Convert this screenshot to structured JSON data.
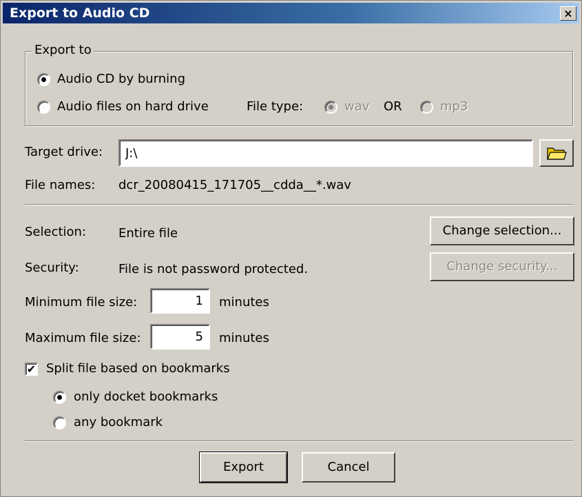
{
  "window": {
    "title": "Export to Audio CD",
    "close_label": "×"
  },
  "export_to": {
    "legend": "Export to",
    "option_cd": "Audio CD by burning",
    "option_files": "Audio files on hard drive",
    "file_type_label": "File type:",
    "wav": "wav",
    "or": "OR",
    "mp3": "mp3",
    "selected": "Audio CD by burning",
    "file_type_selected": "wav"
  },
  "target": {
    "label": "Target drive:",
    "value": "J:\\"
  },
  "file_names": {
    "label": "File names:",
    "value": "dcr_20080415_171705__cdda__*.wav"
  },
  "selection": {
    "label": "Selection:",
    "value": "Entire file",
    "button": "Change selection..."
  },
  "security": {
    "label": "Security:",
    "value": "File is not password protected.",
    "button": "Change security..."
  },
  "min_size": {
    "label": "Minimum file size:",
    "value": "1",
    "unit": "minutes"
  },
  "max_size": {
    "label": "Maximum file size:",
    "value": "5",
    "unit": "minutes"
  },
  "split": {
    "label": "Split file based on bookmarks",
    "checked": true,
    "check_mark": "✔",
    "option_docket": "only docket bookmarks",
    "option_any": "any bookmark",
    "selected": "only docket bookmarks"
  },
  "buttons": {
    "export": "Export",
    "cancel": "Cancel"
  },
  "icons": {
    "folder": "folder-icon"
  }
}
